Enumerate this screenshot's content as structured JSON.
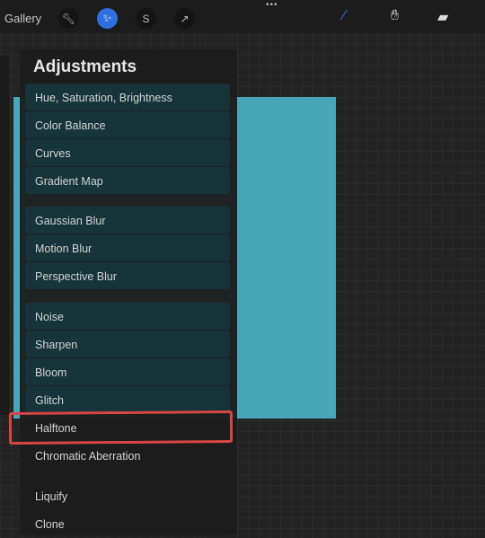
{
  "toolbar": {
    "gallery": "Gallery",
    "tools": [
      "wrench-icon",
      "magic-wand-icon",
      "selection-s-icon",
      "transform-arrow-icon"
    ],
    "active_tool": "magic-wand-icon",
    "right_tools": [
      "brush-icon",
      "smudge-icon",
      "eraser-icon"
    ],
    "accent": "#2f6fe0"
  },
  "canvas": {
    "color": "#48a6b8"
  },
  "adjustments": {
    "title": "Adjustments",
    "groups": [
      [
        "Hue, Saturation, Brightness",
        "Color Balance",
        "Curves",
        "Gradient Map"
      ],
      [
        "Gaussian Blur",
        "Motion Blur",
        "Perspective Blur"
      ],
      [
        "Noise",
        "Sharpen",
        "Bloom",
        "Glitch",
        "Halftone",
        "Chromatic Aberration"
      ],
      [
        "Liquify",
        "Clone"
      ]
    ],
    "highlighted": "Halftone",
    "highlight_color": "#d94444"
  }
}
